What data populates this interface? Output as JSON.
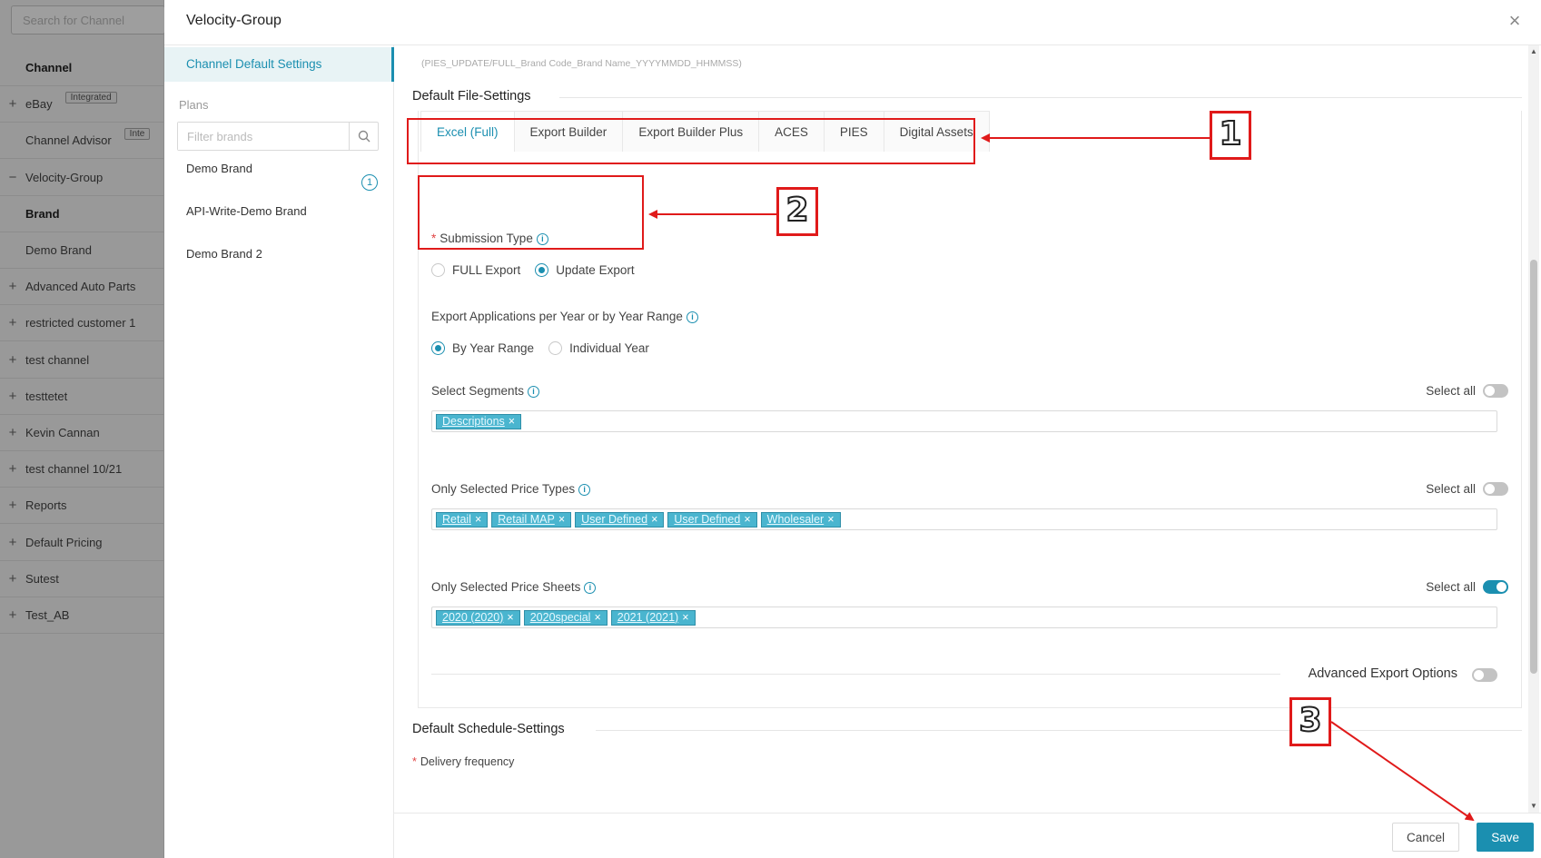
{
  "background_app": {
    "search_placeholder": "Search for Channel",
    "rows": [
      {
        "prefix": "",
        "label": "Channel",
        "bold": true
      },
      {
        "prefix": "+",
        "label": "eBay",
        "badge": "Integrated"
      },
      {
        "prefix": "",
        "label": "Channel Advisor",
        "badge": "Inte"
      },
      {
        "prefix": "−",
        "label": "Velocity-Group"
      },
      {
        "prefix": "",
        "label": "Brand",
        "bold": true
      },
      {
        "prefix": "",
        "label": "Demo Brand"
      },
      {
        "prefix": "+",
        "label": "Advanced Auto Parts"
      },
      {
        "prefix": "+",
        "label": "restricted customer 1"
      },
      {
        "prefix": "+",
        "label": "test channel"
      },
      {
        "prefix": "+",
        "label": "testtetet"
      },
      {
        "prefix": "+",
        "label": "Kevin Cannan"
      },
      {
        "prefix": "+",
        "label": "test channel 10/21"
      },
      {
        "prefix": "+",
        "label": "Reports"
      },
      {
        "prefix": "+",
        "label": "Default Pricing"
      },
      {
        "prefix": "+",
        "label": "Sutest"
      },
      {
        "prefix": "+",
        "label": "Test_AB"
      }
    ]
  },
  "modal": {
    "title": "Velocity-Group",
    "close_icon": "close-icon",
    "nav_active": "Channel Default Settings",
    "plans_label": "Plans",
    "filter_placeholder": "Filter brands",
    "brands": [
      {
        "name": "Demo Brand",
        "count": "1"
      },
      {
        "name": "API-Write-Demo Brand"
      },
      {
        "name": "Demo Brand 2"
      }
    ]
  },
  "main": {
    "file_name_hint": "(PIES_UPDATE/FULL_Brand Code_Brand Name_YYYYMMDD_HHMMSS)",
    "file_settings_title": "Default File-Settings",
    "tabs": [
      "Excel (Full)",
      "Export Builder",
      "Export Builder Plus",
      "ACES",
      "PIES",
      "Digital Assets"
    ],
    "active_tab": "Excel (Full)",
    "submission_type": {
      "label": "Submission Type",
      "options": [
        "FULL Export",
        "Update Export"
      ],
      "selected": "Update Export"
    },
    "export_applications": {
      "label": "Export Applications per Year or by Year Range",
      "options": [
        "By Year Range",
        "Individual Year"
      ],
      "selected": "By Year Range"
    },
    "segments": {
      "label": "Select Segments",
      "select_all_label": "Select all",
      "select_all_on": false,
      "tags": [
        "Descriptions"
      ]
    },
    "price_types": {
      "label": "Only Selected Price Types",
      "select_all_label": "Select all",
      "select_all_on": false,
      "tags": [
        "Retail",
        "Retail MAP",
        "User Defined",
        "User Defined",
        "Wholesaler"
      ]
    },
    "price_sheets": {
      "label": "Only Selected Price Sheets",
      "select_all_label": "Select all",
      "select_all_on": true,
      "tags": [
        "2020 (2020)",
        "2020special",
        "2021 (2021)"
      ]
    },
    "advanced_export": {
      "label": "Advanced Export Options",
      "on": false
    },
    "schedule_title": "Default Schedule-Settings",
    "delivery_label": "Delivery frequency"
  },
  "footer": {
    "cancel_label": "Cancel",
    "save_label": "Save"
  },
  "annotations": {
    "numbers": [
      "1",
      "2",
      "3"
    ],
    "color": "#e01a1a"
  },
  "colors": {
    "accent": "#1b8fb0",
    "tag_bg": "#4ab5cf",
    "annotation": "#e01a1a"
  }
}
